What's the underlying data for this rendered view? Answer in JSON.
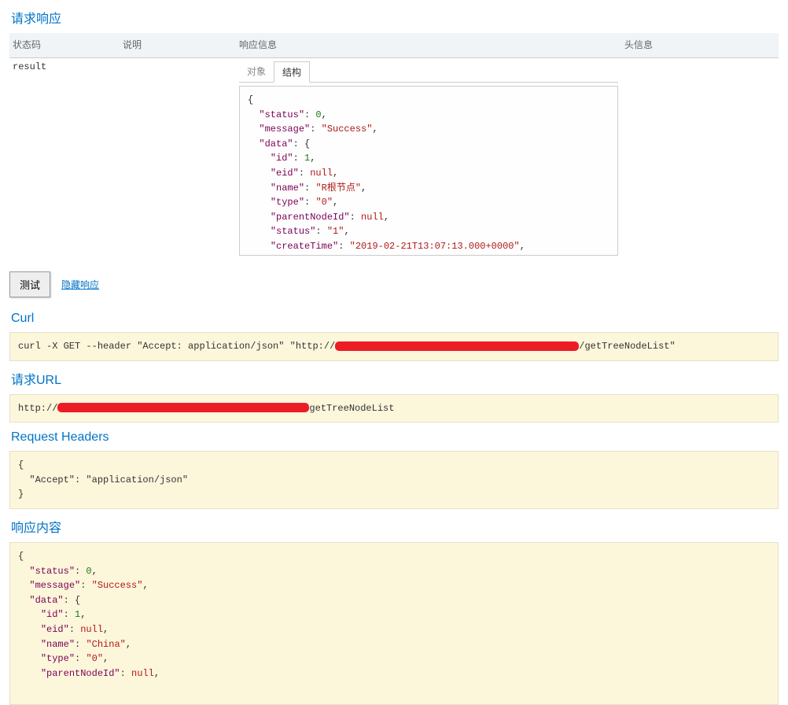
{
  "title": "请求响应",
  "columns": {
    "code": "状态码",
    "desc": "说明",
    "resp": "响应信息",
    "head": "头信息"
  },
  "row_code": "result",
  "tabs": {
    "object": "对象",
    "struct": "结构"
  },
  "actions": {
    "test": "测试",
    "hide": "隐藏响应"
  },
  "sections": {
    "curl": "Curl",
    "url": "请求URL",
    "headers": "Request Headers",
    "body": "响应内容"
  },
  "curl_prefix": "curl -X GET --header \"Accept: application/json\" \"http://",
  "curl_suffix": "/getTreeNodeList\"",
  "url_prefix": "http://",
  "url_suffix": "getTreeNodeList",
  "headers_body": "{\n  \"Accept\": \"application/json\"\n}",
  "json1": {
    "status_k": "\"status\"",
    "status_v": "0",
    "message_k": "\"message\"",
    "message_v": "\"Success\"",
    "data_k": "\"data\"",
    "id_k": "\"id\"",
    "id_v": "1",
    "eid_k": "\"eid\"",
    "eid_v": "null",
    "name_k": "\"name\"",
    "name_v": "\"R根节点\"",
    "type_k": "\"type\"",
    "type_v": "\"0\"",
    "parent_k": "\"parentNodeId\"",
    "parent_v": "null",
    "status2_k": "\"status\"",
    "status2_v": "\"1\"",
    "ctime_k": "\"createTime\"",
    "ctime_v": "\"2019-02-21T13:07:13.000+0000\""
  },
  "json2": {
    "status_k": "\"status\"",
    "status_v": "0",
    "message_k": "\"message\"",
    "message_v": "\"Success\"",
    "data_k": "\"data\"",
    "id_k": "\"id\"",
    "id_v": "1",
    "eid_k": "\"eid\"",
    "eid_v": "null",
    "name_k": "\"name\"",
    "name_v": "\"China\"",
    "type_k": "\"type\"",
    "type_v": "\"0\"",
    "parent_k": "\"parentNodeId\"",
    "parent_v": "null"
  }
}
